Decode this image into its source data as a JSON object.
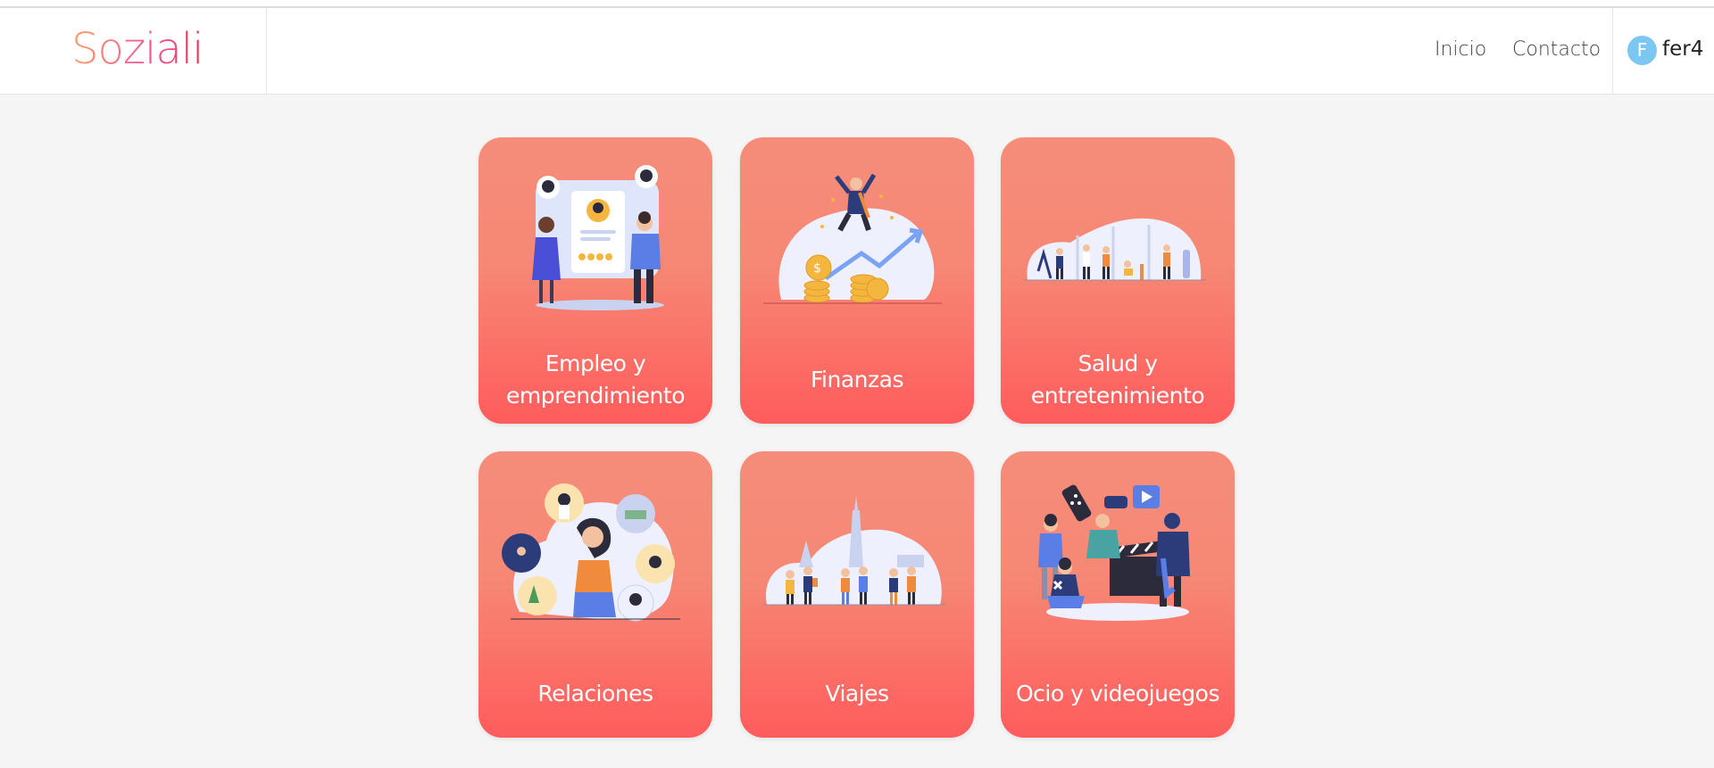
{
  "app": {
    "brand": "Soziali"
  },
  "nav": {
    "items": [
      {
        "label": "Inicio"
      },
      {
        "label": "Contacto"
      }
    ],
    "user": {
      "initial": "F",
      "name": "fer4",
      "avatar_color": "#7cc6f2"
    }
  },
  "categories": [
    {
      "label_line1": "Empleo y",
      "label_line2": "emprendimiento",
      "icon": "employment-illustration"
    },
    {
      "label": "Finanzas",
      "icon": "finance-illustration"
    },
    {
      "label_line1": "Salud y",
      "label_line2": "entretenimiento",
      "icon": "fitness-illustration"
    },
    {
      "label": "Relaciones",
      "icon": "relationships-illustration"
    },
    {
      "label": "Viajes",
      "icon": "travel-illustration"
    },
    {
      "label": "Ocio y videojuegos",
      "icon": "leisure-games-illustration"
    }
  ],
  "colors": {
    "card_top": "#f58d7a",
    "card_bottom": "#ff5c5c",
    "brand_gradient": [
      "#f9a068",
      "#f0559a",
      "#e8334f"
    ],
    "background": "#f5f5f5"
  }
}
